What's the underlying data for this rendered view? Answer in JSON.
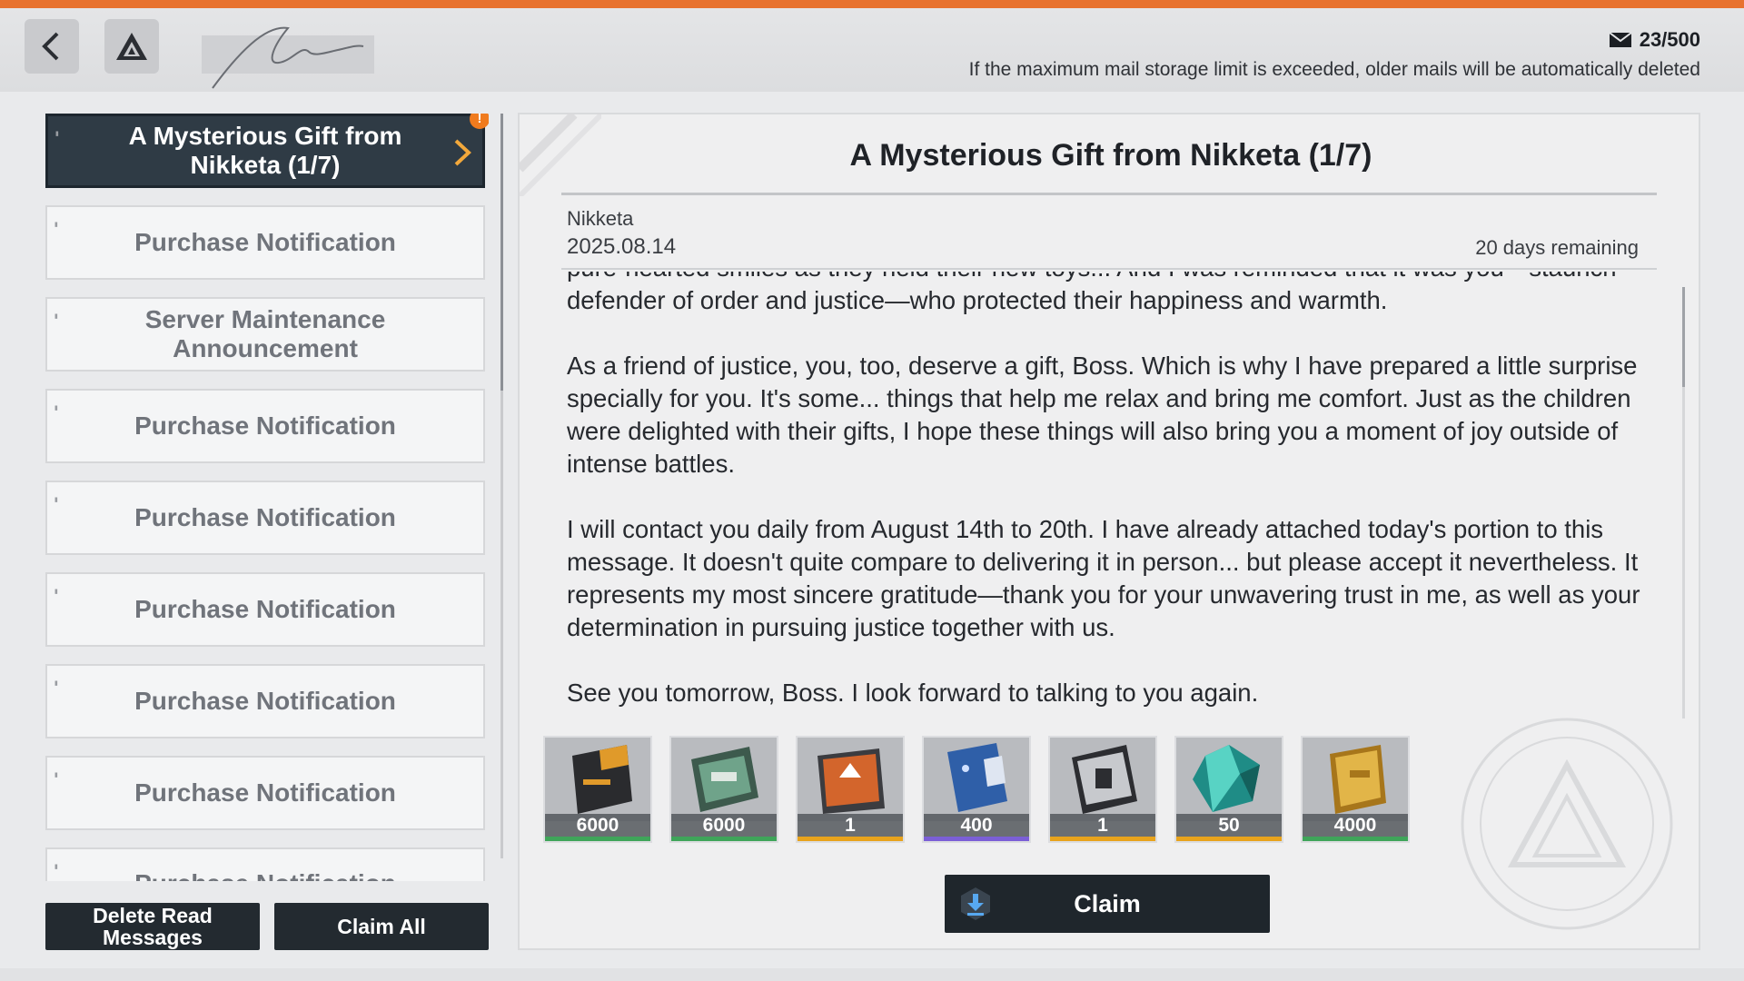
{
  "header": {
    "back_label": "Back",
    "mail_count": "23/500",
    "storage_note": "If the maximum mail storage limit is exceeded, older mails will be automatically deleted"
  },
  "mail_list": [
    {
      "title": "A Mysterious Gift from Nikketa (1/7)",
      "active": true,
      "unread": true,
      "badge": "!"
    },
    {
      "title": "Purchase Notification"
    },
    {
      "title": "Server Maintenance Announcement"
    },
    {
      "title": "Purchase Notification"
    },
    {
      "title": "Purchase Notification"
    },
    {
      "title": "Purchase Notification"
    },
    {
      "title": "Purchase Notification"
    },
    {
      "title": "Purchase Notification"
    },
    {
      "title": "Purchase Notification"
    }
  ],
  "buttons": {
    "delete_read": "Delete Read Messages",
    "claim_all": "Claim All",
    "claim": "Claim"
  },
  "mail": {
    "title": "A Mysterious Gift from Nikketa (1/7)",
    "sender": "Nikketa",
    "date": "2025.08.14",
    "remaining": "20 days remaining",
    "paragraphs": [
      "pure-hearted smiles as they held their new toys... And I was reminded that it was you—staunch defender of order and justice—who protected their happiness and warmth.",
      "As a friend of justice, you, too, deserve a gift, Boss. Which is why I have prepared a little surprise specially for you. It's some... things that help me relax and bring me comfort. Just as the children were delighted with their gifts, I hope these things will also bring you a moment of joy outside of intense battles.",
      "I will contact you daily from August 14th to 20th. I have already attached today's portion to this message. It doesn't quite compare to delivering it in person... but please accept it nevertheless. It represents my most sincere gratitude—thank you for your unwavering trust in me, as well as your determination in pursuing justice together with us.",
      "See you tomorrow, Boss. I look forward to talking to you again."
    ]
  },
  "rewards": [
    {
      "icon": "black-gold-crate-icon",
      "qty": "6000",
      "rarity_color": "#3fa55a"
    },
    {
      "icon": "green-pistol-case-icon",
      "qty": "6000",
      "rarity_color": "#3fa55a"
    },
    {
      "icon": "orange-upgrade-module-icon",
      "qty": "1",
      "rarity_color": "#e8a31c"
    },
    {
      "icon": "blue-data-card-icon",
      "qty": "400",
      "rarity_color": "#7b5fd6"
    },
    {
      "icon": "silver-chip-card-icon",
      "qty": "1",
      "rarity_color": "#e8a31c"
    },
    {
      "icon": "teal-crystal-icon",
      "qty": "50",
      "rarity_color": "#e8a31c"
    },
    {
      "icon": "gold-credit-bar-icon",
      "qty": "4000",
      "rarity_color": "#3fa55a"
    }
  ],
  "colors": {
    "accent": "#e8722f",
    "active_item": "#2f3b45",
    "chevron": "#f2a83b"
  }
}
